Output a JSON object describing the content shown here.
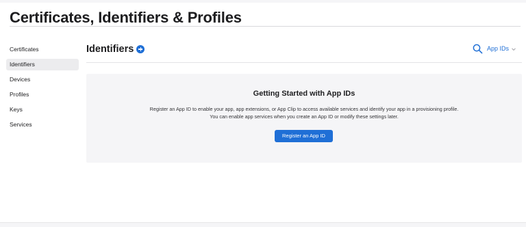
{
  "page": {
    "title": "Certificates, Identifiers & Profiles"
  },
  "sidebar": {
    "items": [
      {
        "label": "Certificates",
        "active": false
      },
      {
        "label": "Identifiers",
        "active": true
      },
      {
        "label": "Devices",
        "active": false
      },
      {
        "label": "Profiles",
        "active": false
      },
      {
        "label": "Keys",
        "active": false
      },
      {
        "label": "Services",
        "active": false
      }
    ]
  },
  "section": {
    "title": "Identifiers",
    "add_icon": "plus-circle-icon",
    "search_icon": "search-icon",
    "filter_selected": "App IDs",
    "filter_icon": "chevron-down-icon"
  },
  "empty_state": {
    "title": "Getting Started with App IDs",
    "description_line1": "Register an App ID to enable your app, app extensions, or App Clip to access available services and identify your app in a provisioning profile.",
    "description_line2": "You can enable app services when you create an App ID or modify these settings later.",
    "button_label": "Register an App ID"
  },
  "colors": {
    "accent": "#1f6fd6",
    "text": "#1d1d1f",
    "card_background": "#f5f5f7",
    "active_item_background": "#ececee"
  }
}
